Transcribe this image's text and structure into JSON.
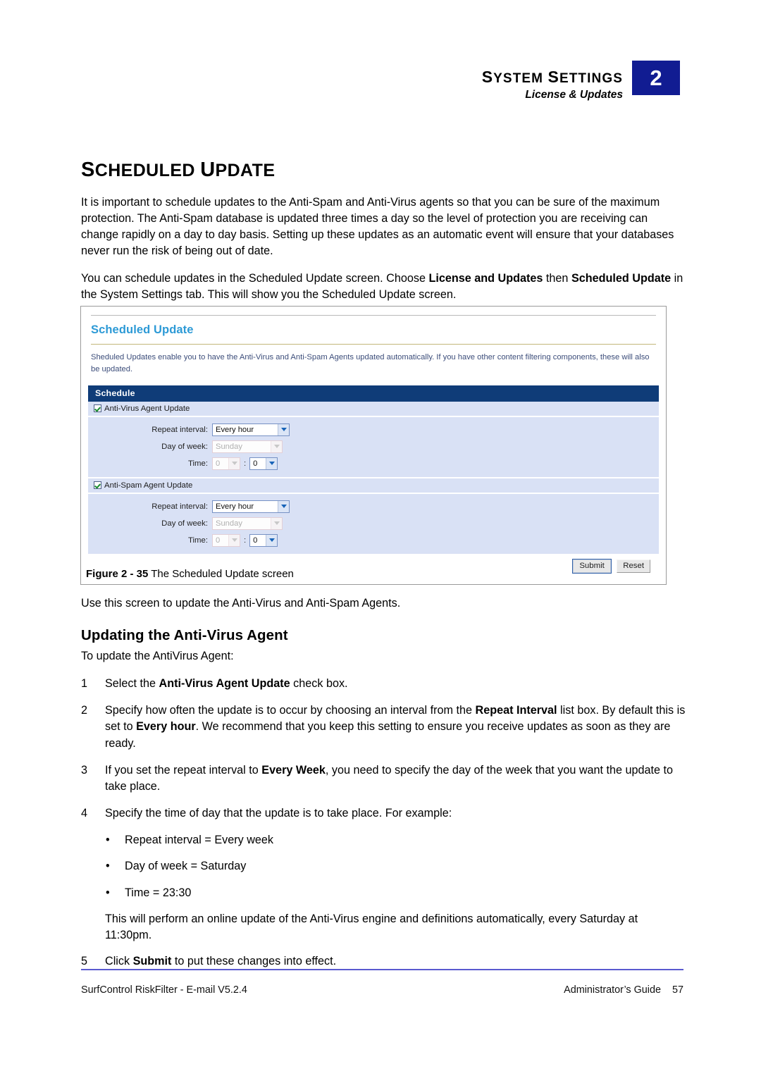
{
  "header": {
    "title": "System Settings",
    "subtitle": "License & Updates",
    "chapter_number": "2",
    "chapter_badge_color": "#111c92"
  },
  "section": {
    "title": "Scheduled Update",
    "paragraph_1": "It is important to schedule updates to the Anti-Spam and Anti-Virus agents so that you can be sure of the maximum protection. The Anti-Spam database is updated three times a day so the level of protection you are receiving can change rapidly on a day to day basis. Setting up these updates as an automatic event will ensure that your databases never run the risk of being out of date.",
    "paragraph_2_part1": "You can schedule updates in the Scheduled Update screen. Choose ",
    "paragraph_2_bold1": "License and Updates",
    "paragraph_2_part2": " then ",
    "paragraph_2_bold2": "Scheduled Update",
    "paragraph_2_part3": " in the System Settings tab. This will show you the Scheduled Update screen."
  },
  "figure": {
    "caption_label": "Figure 2 - 35",
    "caption_text": "The Scheduled Update screen",
    "below_text": "Use this screen to update the Anti-Virus and Anti-Spam Agents.",
    "screen": {
      "title": "Scheduled Update",
      "title_color": "#2d9ad6",
      "description": "Sheduled Updates enable you to have the Anti-Virus and Anti-Spam Agents updated automatically. If you have other content filtering components, these will also be updated.",
      "section_bar_label": "Schedule",
      "section_bar_color": "#0f3c78",
      "panel_color": "#d9e1f5",
      "groups": [
        {
          "checkbox_label": "Anti-Virus Agent Update",
          "checked": true,
          "fields": [
            {
              "label": "Repeat interval:",
              "value": "Every hour",
              "disabled": false
            },
            {
              "label": "Day of week:",
              "value": "Sunday",
              "disabled": true
            }
          ],
          "time_label": "Time:",
          "time_hour": "0",
          "time_hour_disabled": true,
          "time_separator": ":",
          "time_minute": "0",
          "time_minute_disabled": false
        },
        {
          "checkbox_label": "Anti-Spam Agent Update",
          "checked": true,
          "fields": [
            {
              "label": "Repeat interval:",
              "value": "Every hour",
              "disabled": false
            },
            {
              "label": "Day of week:",
              "value": "Sunday",
              "disabled": true
            }
          ],
          "time_label": "Time:",
          "time_hour": "0",
          "time_hour_disabled": true,
          "time_separator": ":",
          "time_minute": "0",
          "time_minute_disabled": false
        }
      ],
      "buttons": {
        "submit": "Submit",
        "reset": "Reset"
      }
    }
  },
  "procedure": {
    "heading": "Updating the Anti-Virus Agent",
    "intro": "To update the AntiVirus Agent:",
    "steps": [
      {
        "num": "1",
        "pre": "Select the ",
        "bold": "Anti-Virus Agent Update",
        "post": " check box."
      },
      {
        "num": "2",
        "pre": "Specify how often the update is to occur by choosing an interval from the ",
        "bold": "Repeat Interval",
        "post": " list box. By default this is set to ",
        "bold2": "Every hour",
        "post2": ". We recommend that you keep this setting to ensure you receive updates as soon as they are ready."
      },
      {
        "num": "3",
        "pre": "If you set the repeat interval to ",
        "bold": "Every Week",
        "post": ", you need to specify the day of the week that you want the update to take place."
      },
      {
        "num": "4",
        "pre": "Specify the time of day that the update is to take place. For example:",
        "bold": "",
        "post": ""
      },
      {
        "num": "5",
        "pre": "Click ",
        "bold": "Submit",
        "post": " to put these changes into effect."
      }
    ],
    "bullets": [
      "Repeat interval = Every week",
      "Day of week = Saturday",
      "Time = 23:30"
    ],
    "note": "This will perform an online update of the Anti-Virus engine and definitions automatically, every Saturday at 11:30pm."
  },
  "footer": {
    "left": "SurfControl RiskFilter - E-mail V5.2.4",
    "right_label": "Administrator’s Guide",
    "page_number": "57",
    "rule_color": "#5a5ad0"
  }
}
